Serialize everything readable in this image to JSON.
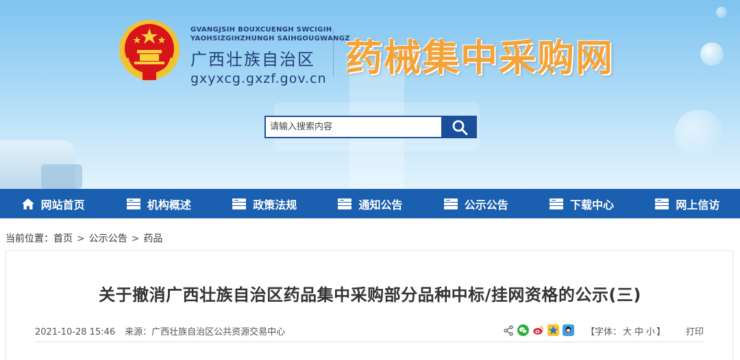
{
  "header": {
    "gov_pinyin_line1": "GVANGJSIH BOUXCUENGH SWCIGIH",
    "gov_pinyin_line2": "YAOHSIZGIHZHUNGH SAIHGOUGWANGZ",
    "gov_name": "广西壮族自治区",
    "gov_url": "gxyxcg.gxzf.gov.cn",
    "site_title": "药械集中采购网",
    "title_color": "#f4a338",
    "emblem_icon": "national-emblem-icon"
  },
  "search": {
    "placeholder": "请输入搜索内容",
    "button_icon": "search-icon"
  },
  "nav": {
    "background": "#1a5fb0",
    "items": [
      {
        "label": "网站首页",
        "icon": "home-icon"
      },
      {
        "label": "机构概述",
        "icon": "list-icon"
      },
      {
        "label": "政策法规",
        "icon": "list-icon"
      },
      {
        "label": "通知公告",
        "icon": "list-icon"
      },
      {
        "label": "公示公告",
        "icon": "list-icon"
      },
      {
        "label": "下载中心",
        "icon": "list-icon"
      },
      {
        "label": "网上信访",
        "icon": "list-icon"
      }
    ]
  },
  "breadcrumb": {
    "prefix": "当前位置：",
    "items": [
      "首页",
      "公示公告",
      "药品"
    ],
    "separator": ">"
  },
  "article": {
    "title": "关于撤消广西壮族自治区药品集中采购部分品种中标/挂网资格的公示(三)",
    "datetime": "2021-10-28 15:46",
    "source": "来源：广西壮族自治区公共资源交易中心",
    "font_size_label": "【字体：",
    "font_sizes": [
      "大",
      "中",
      "小"
    ],
    "font_size_close": "】",
    "print_label": "打印",
    "share_icons": [
      "share-icon",
      "wechat-icon",
      "weibo-icon",
      "qzone-icon",
      "qq-icon"
    ]
  }
}
